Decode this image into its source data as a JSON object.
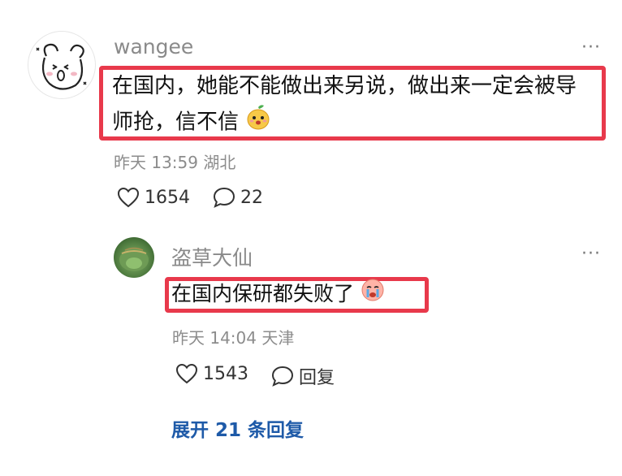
{
  "comment": {
    "username": "wangee",
    "text_line1": "在国内，她能不能做出来另说，做出来一定会被导",
    "text_line2": "师抢，信不信",
    "emoji": "mango-cute-emoji",
    "time": "昨天 13:59",
    "location": "湖北",
    "likes": "1654",
    "replies": "22",
    "more": "···"
  },
  "reply": {
    "username": "盗草大仙",
    "text": "在国内保研都失败了",
    "emoji": "crying-emoji",
    "time": "昨天 14:04",
    "location": "天津",
    "likes": "1543",
    "reply_label": "回复",
    "more": "···"
  },
  "expand_label": "展开 21 条回复",
  "colors": {
    "highlight": "#e8394b",
    "link": "#1e5aa8",
    "meta": "#8c8c8c"
  }
}
